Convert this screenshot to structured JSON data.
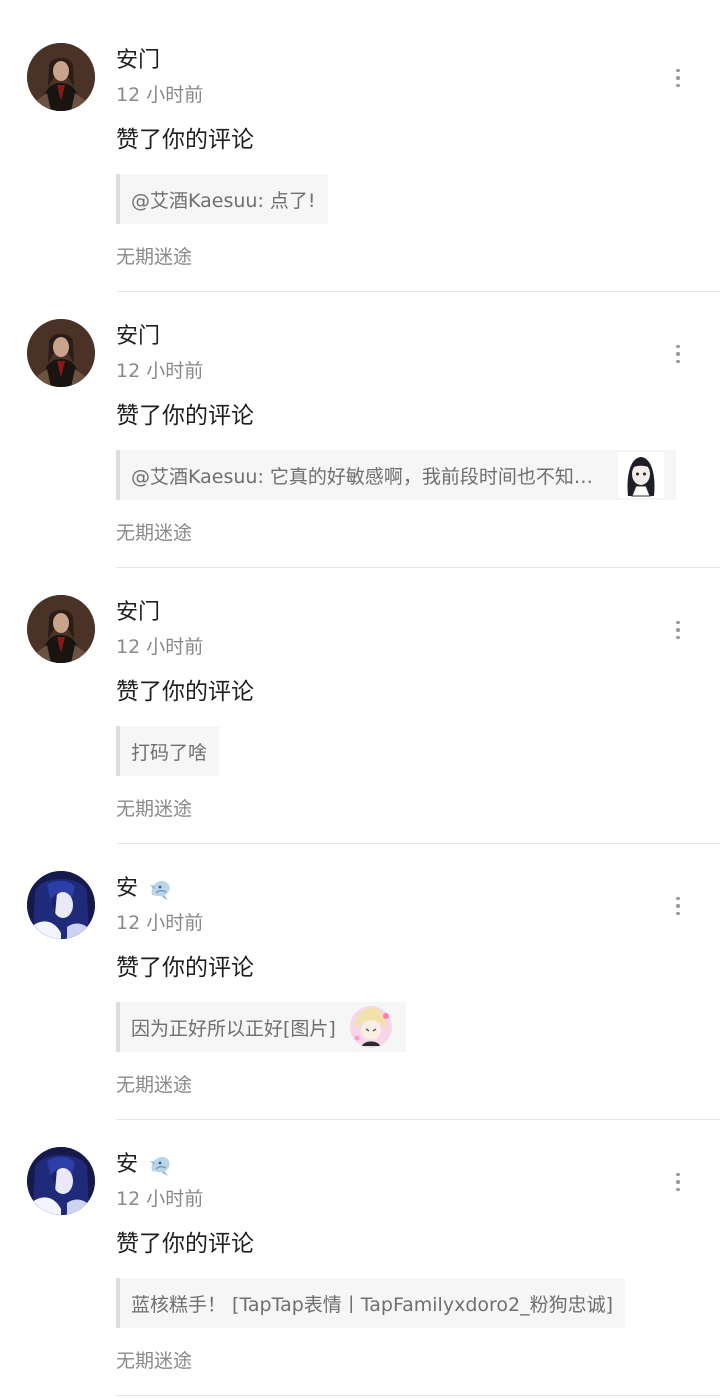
{
  "notifications": [
    {
      "user": "安门",
      "time": "12 小时前",
      "action": "赞了你的评论",
      "quote": "@艾酒Kaesuu: 点了!",
      "source": "无期迷途",
      "avatar_icon": "dark-hair-character-avatar",
      "has_badge": false,
      "thumb_icon": null
    },
    {
      "user": "安门",
      "time": "12 小时前",
      "action": "赞了你的评论",
      "quote": "@艾酒Kaesuu: 它真的好敏感啊，我前段时间也不知道...",
      "source": "无期迷途",
      "avatar_icon": "dark-hair-character-avatar",
      "has_badge": false,
      "thumb_icon": "sketch-girl-sticker-thumbnail"
    },
    {
      "user": "安门",
      "time": "12 小时前",
      "action": "赞了你的评论",
      "quote": "打码了啥",
      "source": "无期迷途",
      "avatar_icon": "dark-hair-character-avatar",
      "has_badge": false,
      "thumb_icon": null
    },
    {
      "user": "安",
      "time": "12 小时前",
      "action": "赞了你的评论",
      "quote": "因为正好所以正好[图片]",
      "source": "无期迷途",
      "avatar_icon": "blue-hair-character-avatar",
      "has_badge": true,
      "thumb_icon": "blonde-chibi-sticker-thumbnail"
    },
    {
      "user": "安",
      "time": "12 小时前",
      "action": "赞了你的评论",
      "quote": "蓝核糕手！ [TapTap表情丨TapFamilyxdoro2_粉狗忠诚]",
      "source": "无期迷途",
      "avatar_icon": "blue-hair-character-avatar",
      "has_badge": true,
      "thumb_icon": null
    }
  ],
  "colors": {
    "background": "#ffffff",
    "primary_text": "#1f1f1f",
    "secondary_text": "#888888",
    "quote_bg": "#f6f6f7",
    "quote_bar": "#dddddf",
    "divider": "#e6e6e6"
  }
}
